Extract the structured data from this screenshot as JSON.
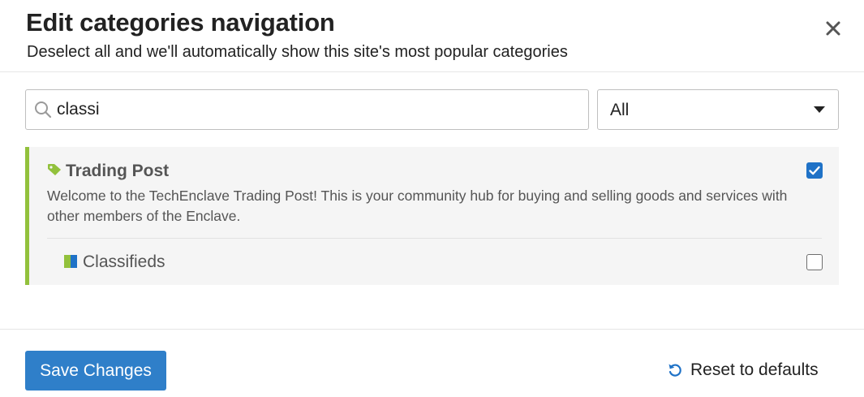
{
  "header": {
    "title": "Edit categories navigation",
    "subtitle": "Deselect all and we'll automatically show this site's most popular categories",
    "close_icon": "close-icon"
  },
  "filters": {
    "search_value": "classi",
    "search_icon": "search-icon",
    "scope_select": {
      "selected": "All"
    }
  },
  "categories": [
    {
      "name": "Trading Post",
      "icon": "tag-icon",
      "color": "#92c13c",
      "description": "Welcome to the TechEnclave Trading Post! This is your community hub for buying and selling goods and services with other members of the Enclave.",
      "checked": true,
      "subcategories": [
        {
          "name": "Classifieds",
          "colors": [
            "#92c13c",
            "#1f72c7"
          ],
          "checked": false
        }
      ]
    }
  ],
  "footer": {
    "save_label": "Save Changes",
    "reset_label": "Reset to defaults",
    "reset_icon": "undo-icon"
  },
  "colors": {
    "accent": "#2f7fc9",
    "checkbox_checked": "#1f72c7",
    "category_bar": "#92c13c"
  }
}
